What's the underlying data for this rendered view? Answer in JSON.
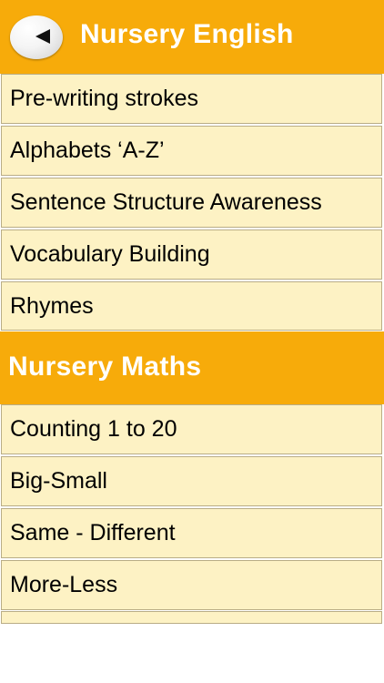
{
  "english": {
    "title": "Nursery English",
    "items": [
      {
        "label": "Pre-writing strokes"
      },
      {
        "label": "Alphabets ‘A-Z’"
      },
      {
        "label": "Sentence Structure Awareness"
      },
      {
        "label": "Vocabulary Building"
      },
      {
        "label": "Rhymes"
      }
    ]
  },
  "maths": {
    "title": "Nursery Maths",
    "items": [
      {
        "label": "Counting 1 to 20"
      },
      {
        "label": "Big-Small"
      },
      {
        "label": "Same - Different"
      },
      {
        "label": "More-Less"
      }
    ]
  },
  "icons": {
    "back": "back-arrow-icon"
  },
  "colors": {
    "header": "#f7ab0a",
    "row": "#fdf2c4",
    "row_border": "#b9ad86",
    "header_text": "#ffffff"
  }
}
